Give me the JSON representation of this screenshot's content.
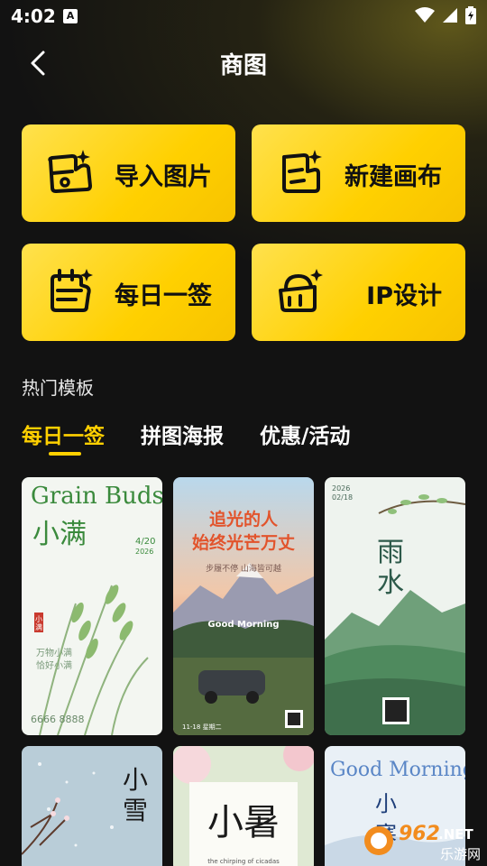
{
  "status_bar": {
    "time": "4:02",
    "notification_letter": "A"
  },
  "header": {
    "title": "商图"
  },
  "tools": [
    {
      "label": "导入图片",
      "icon": "import-image-icon"
    },
    {
      "label": "新建画布",
      "icon": "new-canvas-icon"
    },
    {
      "label": "每日一签",
      "icon": "daily-sign-icon"
    },
    {
      "label": "IP设计",
      "icon": "ip-design-icon"
    }
  ],
  "section": {
    "title": "热门模板"
  },
  "tabs": [
    {
      "label": "每日一签",
      "active": true
    },
    {
      "label": "拼图海报",
      "active": false
    },
    {
      "label": "优惠/活动",
      "active": false
    }
  ],
  "templates": [
    {
      "title_en": "Grain Buds",
      "title_cn": "小满",
      "date": "4/20",
      "year": "2026",
      "seal": "小满",
      "poem1": "万物小满",
      "poem2": "恰好小满",
      "phone": "6666 8888"
    },
    {
      "headline1": "追光的人",
      "headline2": "始终光芒万丈",
      "tagline": "步履不停 山海皆可越",
      "greeting": "Good Morning",
      "footer": "11-18 星期二"
    },
    {
      "year": "2026",
      "date": "02/18",
      "title1": "雨",
      "title2": "水"
    },
    {
      "title1": "小",
      "title2": "雪"
    },
    {
      "title": "小暑",
      "caption": "the chirping of cicadas"
    },
    {
      "greeting": "Good Morning",
      "title1": "小",
      "title2": "寒"
    }
  ],
  "watermark": {
    "logo": "962",
    "suffix": ".NET",
    "site": "乐游网"
  },
  "colors": {
    "accent": "#ffd000",
    "background": "#121212",
    "tile_text": "#111111"
  }
}
